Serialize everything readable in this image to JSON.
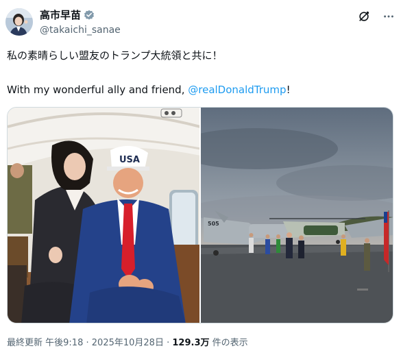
{
  "author": {
    "display_name": "高市早苗",
    "handle": "@takaichi_sanae",
    "avatar_icon": "avatar-photo",
    "verified_icon": "verified-badge-icon",
    "verified_color": "#829aab"
  },
  "header_actions": {
    "grok_icon": "grok-icon",
    "more_icon": "more-options-icon"
  },
  "tweet": {
    "line_jp": "私の素晴らしい盟友のトランプ大統領と共に！",
    "line_en_prefix": "With my wonderful ally and friend, ",
    "mention": "@realDonaldTrump",
    "line_en_suffix": "!",
    "mention_color": "#1d9bf0"
  },
  "media": {
    "photos": [
      {
        "name": "photo-inside-helicopter",
        "cap_text": "USA"
      },
      {
        "name": "photo-aircraft-carrier-deck",
        "hull_text": "505"
      }
    ]
  },
  "meta": {
    "label": "最終更新",
    "time": "午後9:18",
    "separator": "·",
    "date": "2025年10月28日",
    "views_count": "129.3万",
    "views_label": "件の表示"
  }
}
